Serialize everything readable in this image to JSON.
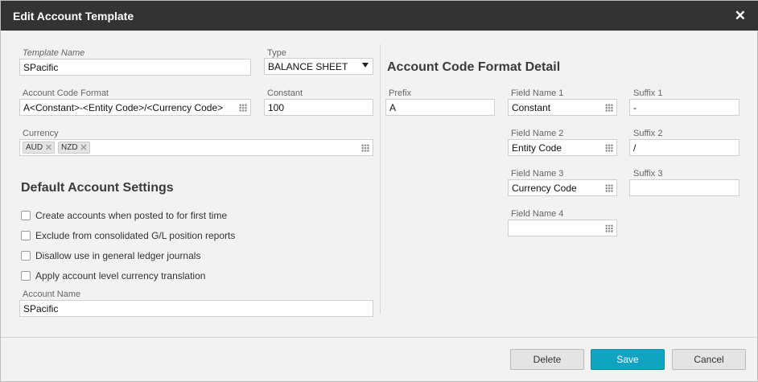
{
  "dialog": {
    "title": "Edit Account Template",
    "close_icon": "close-icon"
  },
  "left": {
    "template_name": {
      "label": "Template Name",
      "value": "SPacific"
    },
    "type": {
      "label": "Type",
      "value": "BALANCE SHEET"
    },
    "account_code_format": {
      "label": "Account Code Format",
      "value": "A<Constant>-<Entity Code>/<Currency Code>"
    },
    "constant": {
      "label": "Constant",
      "value": "100"
    },
    "currency": {
      "label": "Currency",
      "chips": [
        "AUD",
        "NZD"
      ]
    },
    "default_settings_heading": "Default Account Settings",
    "checkboxes": [
      {
        "label": "Create accounts when posted to for first time",
        "checked": false
      },
      {
        "label": "Exclude from consolidated G/L position reports",
        "checked": false
      },
      {
        "label": "Disallow use in general ledger journals",
        "checked": false
      },
      {
        "label": "Apply account level currency translation",
        "checked": false
      }
    ],
    "account_name": {
      "label": "Account Name",
      "value": "SPacific"
    }
  },
  "right": {
    "heading": "Account Code Format Detail",
    "prefix": {
      "label": "Prefix",
      "value": "A"
    },
    "field_names": [
      {
        "label": "Field Name 1",
        "value": "Constant"
      },
      {
        "label": "Field Name 2",
        "value": "Entity Code"
      },
      {
        "label": "Field Name 3",
        "value": "Currency Code"
      },
      {
        "label": "Field Name 4",
        "value": ""
      }
    ],
    "suffixes": [
      {
        "label": "Suffix 1",
        "value": "-"
      },
      {
        "label": "Suffix 2",
        "value": "/"
      },
      {
        "label": "Suffix 3",
        "value": ""
      }
    ]
  },
  "footer": {
    "delete_label": "Delete",
    "save_label": "Save",
    "cancel_label": "Cancel"
  },
  "colors": {
    "titlebar": "#333333",
    "primary_button": "#10a3c2",
    "background": "#f2f2f2"
  }
}
